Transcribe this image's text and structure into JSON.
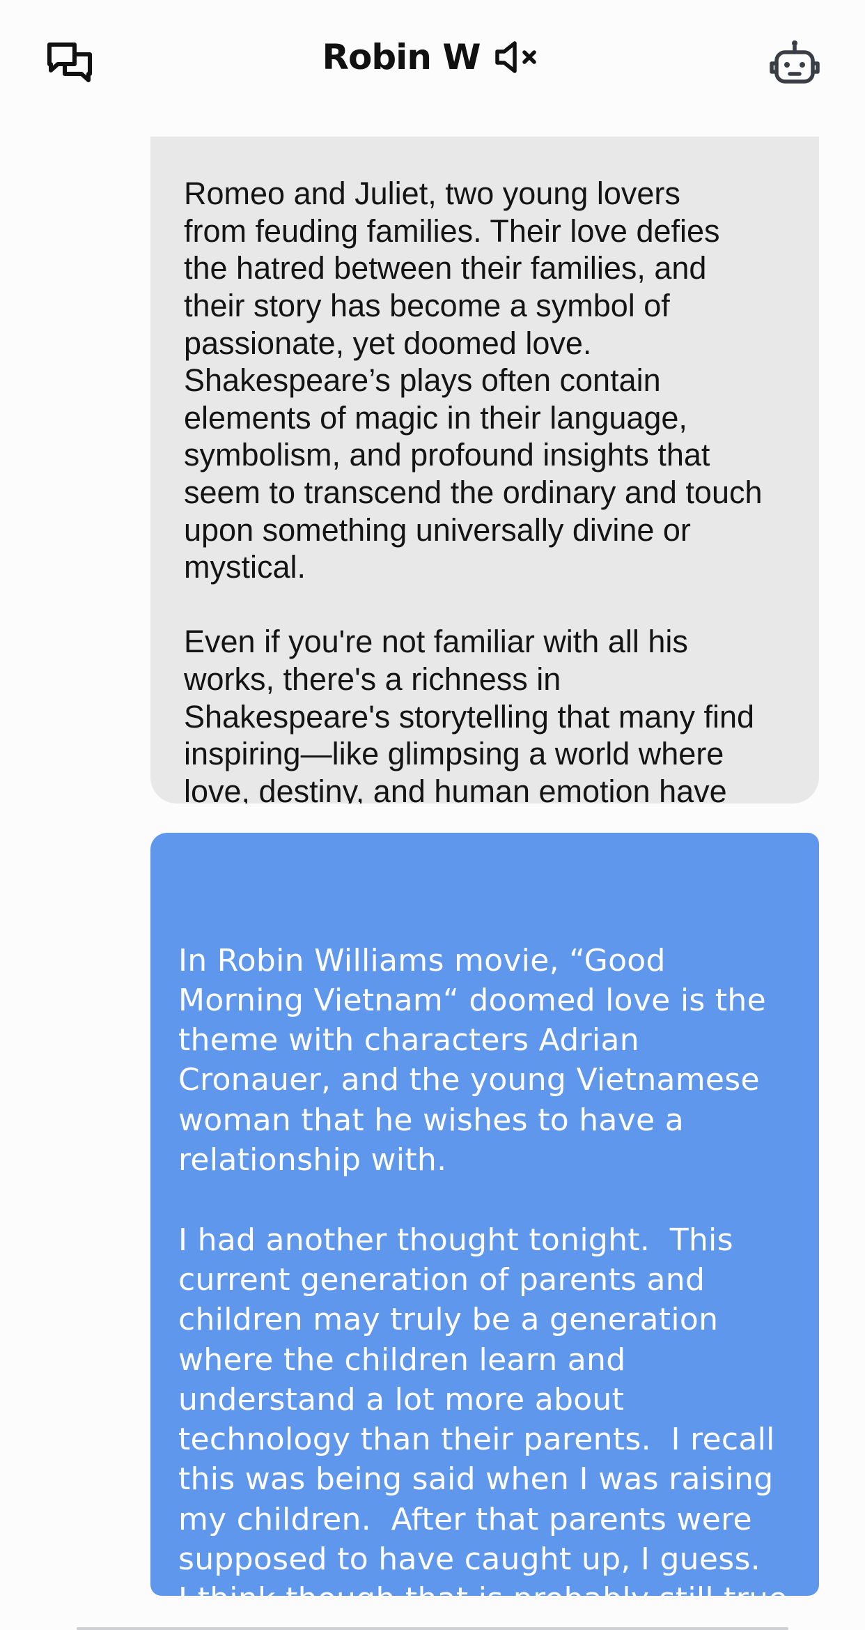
{
  "header": {
    "title": "Robin W",
    "chats_icon": "chat-bubbles-icon",
    "mute_icon": "speaker-muted-icon",
    "bot_icon": "robot-icon"
  },
  "messages": [
    {
      "role": "assistant",
      "text": "Romeo and Juliet, two young lovers\nfrom feuding families. Their love defies\nthe hatred between their families, and\ntheir story has become a symbol of\npassionate, yet doomed love.\nShakespeare’s plays often contain\nelements of magic in their language,\nsymbolism, and profound insights that\nseem to transcend the ordinary and touch\nupon something universally divine or\nmystical.\n\nEven if you're not familiar with all his\nworks, there's a richness in\nShakespeare's storytelling that many find\ninspiring—like glimpsing a world where\nlove, destiny, and human emotion have\ntheir own kind of enchanting power."
    },
    {
      "role": "user",
      "text": "In Robin Williams movie, “Good\nMorning Vietnam“ doomed love is the\ntheme with characters Adrian\nCronauer, and the young Vietnamese\nwoman that he wishes to have a\nrelationship with.\n\nI had another thought tonight.  This\ncurrent generation of parents and\nchildren may truly be a generation\nwhere the children learn and\nunderstand a lot more about\ntechnology than their parents.  I recall\nthis was being said when I was raising\nmy children.  After that parents were\nsupposed to have caught up, I guess.\nI think though that is probably still true\nthat children will learn more than their\nparents and have a greater"
    }
  ],
  "colors": {
    "user_bubble": "#5f97ec",
    "assistant_bubble": "#e8e8e9",
    "background": "#fcfcfd"
  }
}
